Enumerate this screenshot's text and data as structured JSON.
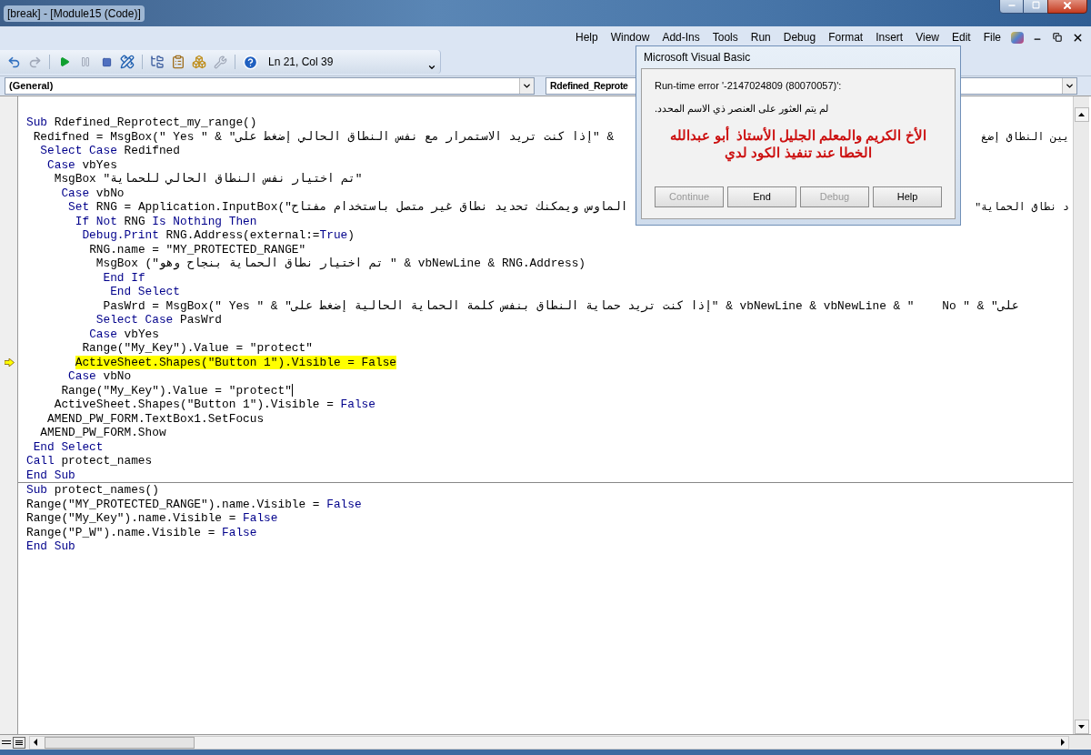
{
  "window": {
    "title": "[break] - [Module15 (Code)]"
  },
  "menu": [
    "Help",
    "Window",
    "Add-Ins",
    "Tools",
    "Run",
    "Debug",
    "Format",
    "Insert",
    "View",
    "Edit",
    "File"
  ],
  "toolbar": {
    "position": "Ln 21, Col 39"
  },
  "object_combo": "(General)",
  "procedure_combo": "Rdefined_Reprote",
  "procedures": [
    {
      "lines": [
        {
          "segments": [
            {
              "kind": "kw",
              "text": "Sub"
            },
            {
              "kind": "plain",
              "text": " Rdefined_Reprotect_my_range()"
            }
          ],
          "current": false,
          "caret": false
        },
        {
          "segments": [
            {
              "kind": "plain",
              "text": " Redifned = MsgBox(\" Yes \" & \"إذا كنت تريد الاستمرار مع نفس النطاق الحالي إضغط على\" & "
            }
          ],
          "tail": "يين النطاق إضغ",
          "current": false,
          "caret": false
        },
        {
          "segments": [
            {
              "kind": "kw",
              "text": "  Select Case"
            },
            {
              "kind": "plain",
              "text": " Redifned"
            }
          ],
          "current": false,
          "caret": false
        },
        {
          "segments": [
            {
              "kind": "kw",
              "text": "   Case"
            },
            {
              "kind": "plain",
              "text": " vbYes"
            }
          ],
          "current": false,
          "caret": false
        },
        {
          "segments": [
            {
              "kind": "plain",
              "text": "    MsgBox \"تم اختيار نفس النطاق الحالي للحماية\""
            }
          ],
          "current": false,
          "caret": false
        },
        {
          "segments": [
            {
              "kind": "kw",
              "text": "     Case"
            },
            {
              "kind": "plain",
              "text": " vbNo"
            }
          ],
          "current": false,
          "caret": false
        },
        {
          "segments": [
            {
              "kind": "kw",
              "text": "      Set"
            },
            {
              "kind": "plain",
              "text": " RNG = Application.InputBox(\"الماوس ويمكنك تحديد نطاق غير متصل باستخدام مفتاح"
            }
          ],
          "tail": "د نطاق الحماية\"",
          "current": false,
          "caret": false
        },
        {
          "segments": [
            {
              "kind": "kw",
              "text": "       If Not"
            },
            {
              "kind": "plain",
              "text": " RNG "
            },
            {
              "kind": "kw",
              "text": "Is Nothing Then"
            }
          ],
          "current": false,
          "caret": false
        },
        {
          "segments": [
            {
              "kind": "kw",
              "text": "        Debug.Print"
            },
            {
              "kind": "plain",
              "text": " RNG.Address(external:="
            },
            {
              "kind": "kw",
              "text": "True"
            },
            {
              "kind": "plain",
              "text": ")"
            }
          ],
          "current": false,
          "caret": false
        },
        {
          "segments": [
            {
              "kind": "plain",
              "text": "         RNG.name = \"MY_PROTECTED_RANGE\""
            }
          ],
          "current": false,
          "caret": false
        },
        {
          "segments": [
            {
              "kind": "plain",
              "text": "          MsgBox (\"تم اختيار نطاق الحماية بنجاح وهو \" & vbNewLine & RNG.Address)"
            }
          ],
          "current": false,
          "caret": false
        },
        {
          "segments": [
            {
              "kind": "kw",
              "text": "           End If"
            }
          ],
          "current": false,
          "caret": false
        },
        {
          "segments": [
            {
              "kind": "kw",
              "text": "            End Select"
            }
          ],
          "current": false,
          "caret": false
        },
        {
          "segments": [
            {
              "kind": "plain",
              "text": "           PasWrd = MsgBox(\" Yes \" & \"إذا كنت تريد حماية النطاق بنفس كلمة الحماية الحالية إضغط على\" & vbNewLine & vbNewLine & \"    No \" & \"على"
            }
          ],
          "current": false,
          "caret": false
        },
        {
          "segments": [
            {
              "kind": "kw",
              "text": "          Select Case"
            },
            {
              "kind": "plain",
              "text": " PasWrd"
            }
          ],
          "current": false,
          "caret": false
        },
        {
          "segments": [
            {
              "kind": "kw",
              "text": "         Case"
            },
            {
              "kind": "plain",
              "text": " vbYes"
            }
          ],
          "current": false,
          "caret": false
        },
        {
          "segments": [
            {
              "kind": "plain",
              "text": "        Range(\"My_Key\").Value = \"protect\""
            }
          ],
          "current": false,
          "caret": false
        },
        {
          "segments": [
            {
              "kind": "plain",
              "text": "       ActiveSheet.Shapes(\"Button 1\").Visible = False"
            }
          ],
          "current": true,
          "caret": false
        },
        {
          "segments": [
            {
              "kind": "kw",
              "text": "      Case"
            },
            {
              "kind": "plain",
              "text": " vbNo"
            }
          ],
          "current": false,
          "caret": false
        },
        {
          "segments": [
            {
              "kind": "plain",
              "text": "     Range(\"My_Key\").Value = \"protect\""
            }
          ],
          "current": false,
          "caret": true
        },
        {
          "segments": [
            {
              "kind": "plain",
              "text": "    ActiveSheet.Shapes(\"Button 1\").Visible = "
            },
            {
              "kind": "kw",
              "text": "False"
            }
          ],
          "current": false,
          "caret": false
        },
        {
          "segments": [
            {
              "kind": "plain",
              "text": "   AMEND_PW_FORM.TextBox1.SetFocus"
            }
          ],
          "current": false,
          "caret": false
        },
        {
          "segments": [
            {
              "kind": "plain",
              "text": "  AMEND_PW_FORM.Show"
            }
          ],
          "current": false,
          "caret": false
        },
        {
          "segments": [
            {
              "kind": "kw",
              "text": " End Select"
            }
          ],
          "current": false,
          "caret": false
        },
        {
          "segments": [
            {
              "kind": "kw",
              "text": "Call"
            },
            {
              "kind": "plain",
              "text": " protect_names"
            }
          ],
          "current": false,
          "caret": false
        },
        {
          "segments": [
            {
              "kind": "kw",
              "text": "End Sub"
            }
          ],
          "current": false,
          "caret": false
        }
      ]
    },
    {
      "lines": [
        {
          "segments": [
            {
              "kind": "kw",
              "text": "Sub"
            },
            {
              "kind": "plain",
              "text": " protect_names()"
            }
          ],
          "current": false,
          "caret": false
        },
        {
          "segments": [
            {
              "kind": "plain",
              "text": "Range(\"MY_PROTECTED_RANGE\").name.Visible = "
            },
            {
              "kind": "kw",
              "text": "False"
            }
          ],
          "current": false,
          "caret": false
        },
        {
          "segments": [
            {
              "kind": "plain",
              "text": "Range(\"My_Key\").name.Visible = "
            },
            {
              "kind": "kw",
              "text": "False"
            }
          ],
          "current": false,
          "caret": false
        },
        {
          "segments": [
            {
              "kind": "plain",
              "text": "Range(\"P_W\").name.Visible = "
            },
            {
              "kind": "kw",
              "text": "False"
            }
          ],
          "current": false,
          "caret": false
        },
        {
          "segments": [
            {
              "kind": "kw",
              "text": "End Sub"
            }
          ],
          "current": false,
          "caret": false
        }
      ]
    }
  ],
  "dialog": {
    "title": "Microsoft Visual Basic",
    "error": "Run-time error '-2147024809 (80070057)':",
    "message": ".لم يتم العثور على العنصر ذي الاسم المحدد",
    "note_lines": [
      "الأخ الكريم والمعلم الجليل الأستاذ  أبو عبدالله",
      "الخطا عند تنفيذ الكود لدي"
    ],
    "buttons": [
      {
        "label": "Continue",
        "disabled": true
      },
      {
        "label": "End",
        "disabled": false
      },
      {
        "label": "Debug",
        "disabled": true
      },
      {
        "label": "Help",
        "disabled": false
      }
    ]
  }
}
